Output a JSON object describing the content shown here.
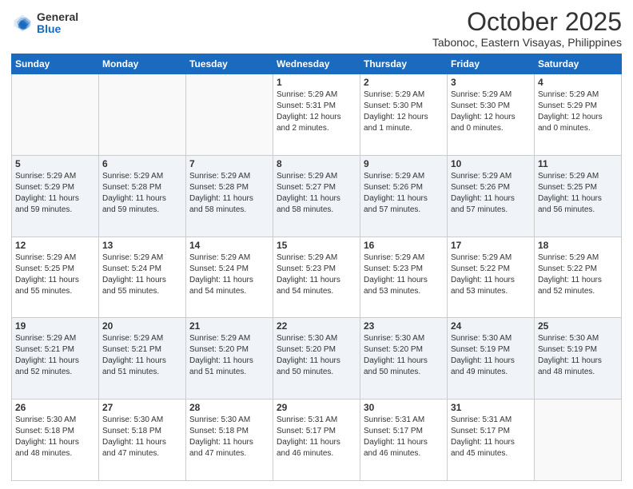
{
  "logo": {
    "general": "General",
    "blue": "Blue"
  },
  "header": {
    "month": "October 2025",
    "location": "Tabonoc, Eastern Visayas, Philippines"
  },
  "weekdays": [
    "Sunday",
    "Monday",
    "Tuesday",
    "Wednesday",
    "Thursday",
    "Friday",
    "Saturday"
  ],
  "weeks": [
    [
      {
        "num": "",
        "info": ""
      },
      {
        "num": "",
        "info": ""
      },
      {
        "num": "",
        "info": ""
      },
      {
        "num": "1",
        "info": "Sunrise: 5:29 AM\nSunset: 5:31 PM\nDaylight: 12 hours\nand 2 minutes."
      },
      {
        "num": "2",
        "info": "Sunrise: 5:29 AM\nSunset: 5:30 PM\nDaylight: 12 hours\nand 1 minute."
      },
      {
        "num": "3",
        "info": "Sunrise: 5:29 AM\nSunset: 5:30 PM\nDaylight: 12 hours\nand 0 minutes."
      },
      {
        "num": "4",
        "info": "Sunrise: 5:29 AM\nSunset: 5:29 PM\nDaylight: 12 hours\nand 0 minutes."
      }
    ],
    [
      {
        "num": "5",
        "info": "Sunrise: 5:29 AM\nSunset: 5:29 PM\nDaylight: 11 hours\nand 59 minutes."
      },
      {
        "num": "6",
        "info": "Sunrise: 5:29 AM\nSunset: 5:28 PM\nDaylight: 11 hours\nand 59 minutes."
      },
      {
        "num": "7",
        "info": "Sunrise: 5:29 AM\nSunset: 5:28 PM\nDaylight: 11 hours\nand 58 minutes."
      },
      {
        "num": "8",
        "info": "Sunrise: 5:29 AM\nSunset: 5:27 PM\nDaylight: 11 hours\nand 58 minutes."
      },
      {
        "num": "9",
        "info": "Sunrise: 5:29 AM\nSunset: 5:26 PM\nDaylight: 11 hours\nand 57 minutes."
      },
      {
        "num": "10",
        "info": "Sunrise: 5:29 AM\nSunset: 5:26 PM\nDaylight: 11 hours\nand 57 minutes."
      },
      {
        "num": "11",
        "info": "Sunrise: 5:29 AM\nSunset: 5:25 PM\nDaylight: 11 hours\nand 56 minutes."
      }
    ],
    [
      {
        "num": "12",
        "info": "Sunrise: 5:29 AM\nSunset: 5:25 PM\nDaylight: 11 hours\nand 55 minutes."
      },
      {
        "num": "13",
        "info": "Sunrise: 5:29 AM\nSunset: 5:24 PM\nDaylight: 11 hours\nand 55 minutes."
      },
      {
        "num": "14",
        "info": "Sunrise: 5:29 AM\nSunset: 5:24 PM\nDaylight: 11 hours\nand 54 minutes."
      },
      {
        "num": "15",
        "info": "Sunrise: 5:29 AM\nSunset: 5:23 PM\nDaylight: 11 hours\nand 54 minutes."
      },
      {
        "num": "16",
        "info": "Sunrise: 5:29 AM\nSunset: 5:23 PM\nDaylight: 11 hours\nand 53 minutes."
      },
      {
        "num": "17",
        "info": "Sunrise: 5:29 AM\nSunset: 5:22 PM\nDaylight: 11 hours\nand 53 minutes."
      },
      {
        "num": "18",
        "info": "Sunrise: 5:29 AM\nSunset: 5:22 PM\nDaylight: 11 hours\nand 52 minutes."
      }
    ],
    [
      {
        "num": "19",
        "info": "Sunrise: 5:29 AM\nSunset: 5:21 PM\nDaylight: 11 hours\nand 52 minutes."
      },
      {
        "num": "20",
        "info": "Sunrise: 5:29 AM\nSunset: 5:21 PM\nDaylight: 11 hours\nand 51 minutes."
      },
      {
        "num": "21",
        "info": "Sunrise: 5:29 AM\nSunset: 5:20 PM\nDaylight: 11 hours\nand 51 minutes."
      },
      {
        "num": "22",
        "info": "Sunrise: 5:30 AM\nSunset: 5:20 PM\nDaylight: 11 hours\nand 50 minutes."
      },
      {
        "num": "23",
        "info": "Sunrise: 5:30 AM\nSunset: 5:20 PM\nDaylight: 11 hours\nand 50 minutes."
      },
      {
        "num": "24",
        "info": "Sunrise: 5:30 AM\nSunset: 5:19 PM\nDaylight: 11 hours\nand 49 minutes."
      },
      {
        "num": "25",
        "info": "Sunrise: 5:30 AM\nSunset: 5:19 PM\nDaylight: 11 hours\nand 48 minutes."
      }
    ],
    [
      {
        "num": "26",
        "info": "Sunrise: 5:30 AM\nSunset: 5:18 PM\nDaylight: 11 hours\nand 48 minutes."
      },
      {
        "num": "27",
        "info": "Sunrise: 5:30 AM\nSunset: 5:18 PM\nDaylight: 11 hours\nand 47 minutes."
      },
      {
        "num": "28",
        "info": "Sunrise: 5:30 AM\nSunset: 5:18 PM\nDaylight: 11 hours\nand 47 minutes."
      },
      {
        "num": "29",
        "info": "Sunrise: 5:31 AM\nSunset: 5:17 PM\nDaylight: 11 hours\nand 46 minutes."
      },
      {
        "num": "30",
        "info": "Sunrise: 5:31 AM\nSunset: 5:17 PM\nDaylight: 11 hours\nand 46 minutes."
      },
      {
        "num": "31",
        "info": "Sunrise: 5:31 AM\nSunset: 5:17 PM\nDaylight: 11 hours\nand 45 minutes."
      },
      {
        "num": "",
        "info": ""
      }
    ]
  ]
}
